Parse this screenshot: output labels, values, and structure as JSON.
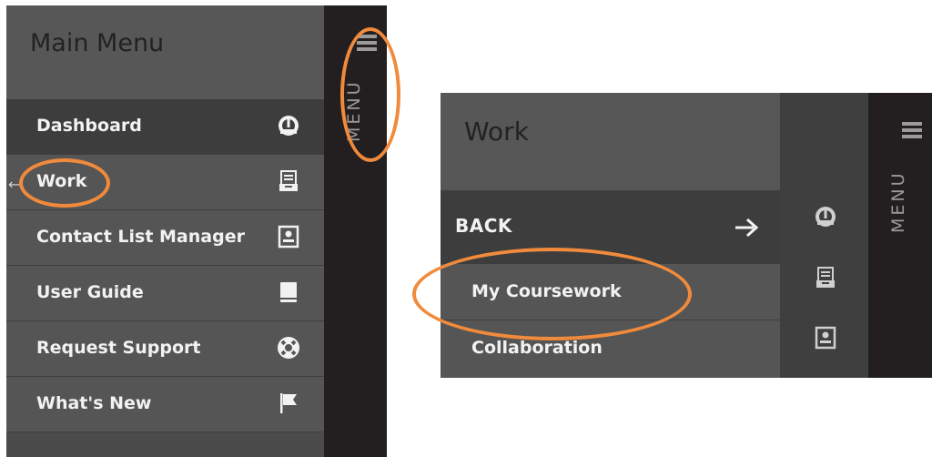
{
  "panel1": {
    "title": "Main Menu",
    "items": [
      {
        "label": "Dashboard",
        "icon": "dashboard-gauge-icon",
        "active": true
      },
      {
        "label": "Work",
        "icon": "work-tray-icon",
        "active": false
      },
      {
        "label": "Contact List Manager",
        "icon": "contact-card-icon",
        "active": false
      },
      {
        "label": "User Guide",
        "icon": "book-icon",
        "active": false
      },
      {
        "label": "Request Support",
        "icon": "lifebuoy-icon",
        "active": false
      },
      {
        "label": "What's New",
        "icon": "flag-icon",
        "active": false
      }
    ],
    "rail_label": "MENU"
  },
  "panel2": {
    "title": "Work",
    "back_label": "BACK",
    "sub_items": [
      {
        "label": "My Coursework"
      },
      {
        "label": "Collaboration"
      }
    ],
    "rail_label": "MENU",
    "icons": [
      "dashboard-gauge-icon",
      "work-tray-icon",
      "contact-card-icon"
    ]
  },
  "colors": {
    "menu_bg": "#555555",
    "active_bg": "#3d3d3d",
    "header_bg": "#575757",
    "rail_bg": "#231f20",
    "text": "#f2f2f2",
    "annotation": "#f08a3c"
  }
}
